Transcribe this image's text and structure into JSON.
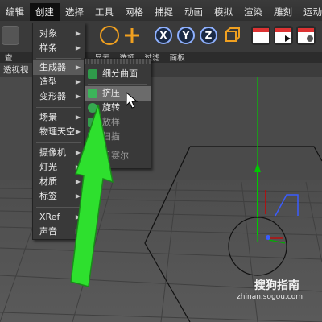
{
  "menubar": {
    "items": [
      "编辑",
      "创建",
      "选择",
      "工具",
      "网格",
      "捕捉",
      "动画",
      "模拟",
      "渲染",
      "雕刻",
      "运动跟"
    ]
  },
  "toolbar": {
    "axis_x": "X",
    "axis_y": "Y",
    "axis_z": "Z"
  },
  "strip": {
    "items": [
      "查",
      "显示",
      "选项",
      "过滤",
      "面板"
    ]
  },
  "viewport": {
    "label": "透视视"
  },
  "create_menu": {
    "items": [
      {
        "label": "对象",
        "submenu": true
      },
      {
        "label": "样条",
        "submenu": true
      },
      {
        "label": "生成器",
        "submenu": true,
        "highlighted": true
      },
      {
        "label": "造型",
        "submenu": true
      },
      {
        "label": "变形器",
        "submenu": true
      },
      {
        "label": "场景",
        "submenu": true
      },
      {
        "label": "物理天空",
        "submenu": true
      },
      {
        "label": "摄像机",
        "submenu": true
      },
      {
        "label": "灯光",
        "submenu": true
      },
      {
        "label": "材质",
        "submenu": true
      },
      {
        "label": "标签",
        "submenu": true
      },
      {
        "label": "XRef",
        "submenu": true
      },
      {
        "label": "声音",
        "submenu": true
      }
    ]
  },
  "generator_menu": {
    "items": [
      {
        "label": "细分曲面"
      },
      {
        "label": "挤压",
        "highlighted": true
      },
      {
        "label": "旋转"
      },
      {
        "label": "放样"
      },
      {
        "label": "扫描"
      },
      {
        "label": "贝赛尔"
      }
    ]
  },
  "watermark": {
    "brand": "搜狗指南",
    "url": "zhinan.sogou.com"
  },
  "colors": {
    "menubar_bg": "#333333",
    "axis_accent": "#8fb1ff",
    "arrow_green": "#2ee02e",
    "y_axis": "#00c800"
  }
}
